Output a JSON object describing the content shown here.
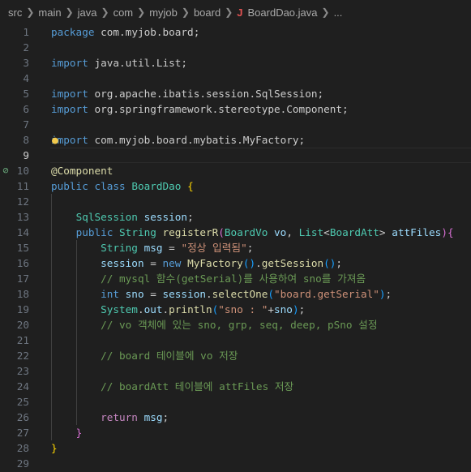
{
  "breadcrumb": {
    "items": [
      "src",
      "main",
      "java",
      "com",
      "myjob",
      "board"
    ],
    "file_icon": "J",
    "file_name": "BoardDao.java",
    "ellipsis": "..."
  },
  "editor": {
    "current_line": 9,
    "gutter_marks": {
      "10": "⊘"
    },
    "lightbulb_line": 8,
    "lines": [
      {
        "n": "1",
        "indent": 0,
        "tokens": [
          [
            "kw",
            "package"
          ],
          [
            "pl",
            " com.myjob.board;"
          ]
        ]
      },
      {
        "n": "2",
        "indent": 0,
        "tokens": []
      },
      {
        "n": "3",
        "indent": 0,
        "tokens": [
          [
            "kw",
            "import"
          ],
          [
            "pl",
            " java.util.List;"
          ]
        ]
      },
      {
        "n": "4",
        "indent": 0,
        "tokens": []
      },
      {
        "n": "5",
        "indent": 0,
        "tokens": [
          [
            "kw",
            "import"
          ],
          [
            "pl",
            " org.apache.ibatis.session.SqlSession;"
          ]
        ]
      },
      {
        "n": "6",
        "indent": 0,
        "tokens": [
          [
            "kw",
            "import"
          ],
          [
            "pl",
            " org.springframework.stereotype.Component;"
          ]
        ]
      },
      {
        "n": "7",
        "indent": 0,
        "tokens": []
      },
      {
        "n": "8",
        "indent": 0,
        "tokens": [
          [
            "kw",
            "import"
          ],
          [
            "pl",
            " com.myjob.board.mybatis.MyFactory;"
          ]
        ]
      },
      {
        "n": "9",
        "indent": 0,
        "tokens": []
      },
      {
        "n": "10",
        "indent": 0,
        "tokens": [
          [
            "ann",
            "@Component"
          ]
        ]
      },
      {
        "n": "11",
        "indent": 0,
        "tokens": [
          [
            "kw",
            "public"
          ],
          [
            "pl",
            " "
          ],
          [
            "kw",
            "class"
          ],
          [
            "pl",
            " "
          ],
          [
            "type",
            "BoardDao"
          ],
          [
            "pl",
            " "
          ],
          [
            "b1",
            "{"
          ]
        ]
      },
      {
        "n": "12",
        "indent": 1,
        "tokens": []
      },
      {
        "n": "13",
        "indent": 1,
        "tokens": [
          [
            "pl",
            "    "
          ],
          [
            "type",
            "SqlSession"
          ],
          [
            "pl",
            " "
          ],
          [
            "var",
            "session"
          ],
          [
            "pl",
            ";"
          ]
        ]
      },
      {
        "n": "14",
        "indent": 1,
        "tokens": [
          [
            "pl",
            "    "
          ],
          [
            "kw",
            "public"
          ],
          [
            "pl",
            " "
          ],
          [
            "type",
            "String"
          ],
          [
            "pl",
            " "
          ],
          [
            "fn",
            "registerR"
          ],
          [
            "b2",
            "("
          ],
          [
            "type",
            "BoardVo"
          ],
          [
            "pl",
            " "
          ],
          [
            "var",
            "vo"
          ],
          [
            "pl",
            ", "
          ],
          [
            "type",
            "List"
          ],
          [
            "pl",
            "<"
          ],
          [
            "type",
            "BoardAtt"
          ],
          [
            "pl",
            "> "
          ],
          [
            "var",
            "attFiles"
          ],
          [
            "b2",
            ")"
          ],
          [
            "b2",
            "{"
          ]
        ]
      },
      {
        "n": "15",
        "indent": 2,
        "tokens": [
          [
            "pl",
            "        "
          ],
          [
            "type",
            "String"
          ],
          [
            "pl",
            " "
          ],
          [
            "var",
            "msg"
          ],
          [
            "pl",
            " = "
          ],
          [
            "str",
            "\"정상 입력됨\""
          ],
          [
            "pl",
            ";"
          ]
        ]
      },
      {
        "n": "16",
        "indent": 2,
        "tokens": [
          [
            "pl",
            "        "
          ],
          [
            "var",
            "session"
          ],
          [
            "pl",
            " = "
          ],
          [
            "kw",
            "new"
          ],
          [
            "pl",
            " "
          ],
          [
            "fn",
            "MyFactory"
          ],
          [
            "b3",
            "()"
          ],
          [
            "pl",
            "."
          ],
          [
            "fn",
            "getSession"
          ],
          [
            "b3",
            "()"
          ],
          [
            "pl",
            ";"
          ]
        ]
      },
      {
        "n": "17",
        "indent": 2,
        "tokens": [
          [
            "pl",
            "        "
          ],
          [
            "cmt",
            "// mysql 함수(getSerial)를 사용하여 sno를 가져옴"
          ]
        ]
      },
      {
        "n": "18",
        "indent": 2,
        "tokens": [
          [
            "pl",
            "        "
          ],
          [
            "kw",
            "int"
          ],
          [
            "pl",
            " "
          ],
          [
            "var",
            "sno"
          ],
          [
            "pl",
            " = "
          ],
          [
            "var",
            "session"
          ],
          [
            "pl",
            "."
          ],
          [
            "fn",
            "selectOne"
          ],
          [
            "b3",
            "("
          ],
          [
            "str",
            "\"board.getSerial\""
          ],
          [
            "b3",
            ")"
          ],
          [
            "pl",
            ";"
          ]
        ]
      },
      {
        "n": "19",
        "indent": 2,
        "tokens": [
          [
            "pl",
            "        "
          ],
          [
            "type",
            "System"
          ],
          [
            "pl",
            "."
          ],
          [
            "var",
            "out"
          ],
          [
            "pl",
            "."
          ],
          [
            "fn",
            "println"
          ],
          [
            "b3",
            "("
          ],
          [
            "str",
            "\"sno : \""
          ],
          [
            "pl",
            "+"
          ],
          [
            "var",
            "sno"
          ],
          [
            "b3",
            ")"
          ],
          [
            "pl",
            ";"
          ]
        ]
      },
      {
        "n": "20",
        "indent": 2,
        "tokens": [
          [
            "pl",
            "        "
          ],
          [
            "cmt",
            "// vo 객체에 있는 sno, grp, seq, deep, pSno 설정"
          ]
        ]
      },
      {
        "n": "21",
        "indent": 2,
        "tokens": []
      },
      {
        "n": "22",
        "indent": 2,
        "tokens": [
          [
            "pl",
            "        "
          ],
          [
            "cmt",
            "// board 테이블에 vo 저장"
          ]
        ]
      },
      {
        "n": "23",
        "indent": 2,
        "tokens": []
      },
      {
        "n": "24",
        "indent": 2,
        "tokens": [
          [
            "pl",
            "        "
          ],
          [
            "cmt",
            "// boardAtt 테이블에 attFiles 저장"
          ]
        ]
      },
      {
        "n": "25",
        "indent": 2,
        "tokens": []
      },
      {
        "n": "26",
        "indent": 2,
        "tokens": [
          [
            "pl",
            "        "
          ],
          [
            "ctl",
            "return"
          ],
          [
            "pl",
            " "
          ],
          [
            "var",
            "msg"
          ],
          [
            "pl",
            ";"
          ]
        ]
      },
      {
        "n": "27",
        "indent": 1,
        "tokens": [
          [
            "pl",
            "    "
          ],
          [
            "b2",
            "}"
          ]
        ]
      },
      {
        "n": "28",
        "indent": 0,
        "tokens": [
          [
            "b1",
            "}"
          ]
        ]
      },
      {
        "n": "29",
        "indent": 0,
        "tokens": []
      }
    ]
  }
}
